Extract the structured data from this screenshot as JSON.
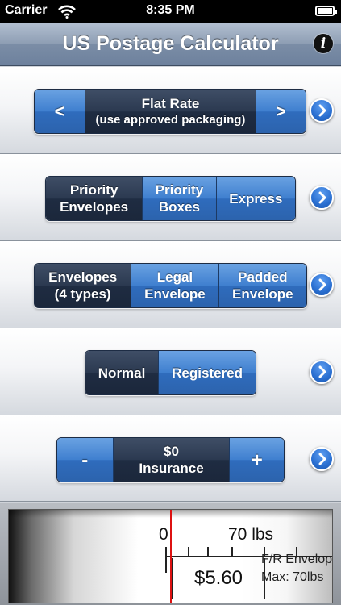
{
  "status_bar": {
    "carrier": "Carrier",
    "time": "8:35 PM"
  },
  "nav": {
    "title": "US Postage Calculator",
    "info_glyph": "i"
  },
  "rate_selector": {
    "prev_label": "<",
    "next_label": ">",
    "title": "Flat Rate",
    "subtitle": "(use approved packaging)"
  },
  "service_segment": {
    "items": [
      {
        "line1": "Priority",
        "line2": "Envelopes",
        "selected": true
      },
      {
        "line1": "Priority",
        "line2": "Boxes",
        "selected": false
      },
      {
        "line1": "Express",
        "line2": "",
        "selected": false
      }
    ]
  },
  "envelope_segment": {
    "items": [
      {
        "line1": "Envelopes",
        "line2": "(4 types)",
        "selected": true
      },
      {
        "line1": "Legal",
        "line2": "Envelope",
        "selected": false
      },
      {
        "line1": "Padded",
        "line2": "Envelope",
        "selected": false
      }
    ]
  },
  "delivery_segment": {
    "items": [
      {
        "label": "Normal",
        "selected": true
      },
      {
        "label": "Registered",
        "selected": false
      }
    ]
  },
  "insurance": {
    "minus_label": "-",
    "plus_label": "+",
    "amount": "$0",
    "label": "Insurance"
  },
  "meter": {
    "scale_min": "0",
    "scale_max": "70 lbs",
    "price": "$5.60",
    "package_name": "F/R Envelope",
    "max_weight": "Max: 70lbs"
  },
  "colors": {
    "segment_blue": "#3f7fcf",
    "segment_dark": "#1f2c42",
    "needle": "#dd1111",
    "nav_bar": "#8d9db3"
  }
}
